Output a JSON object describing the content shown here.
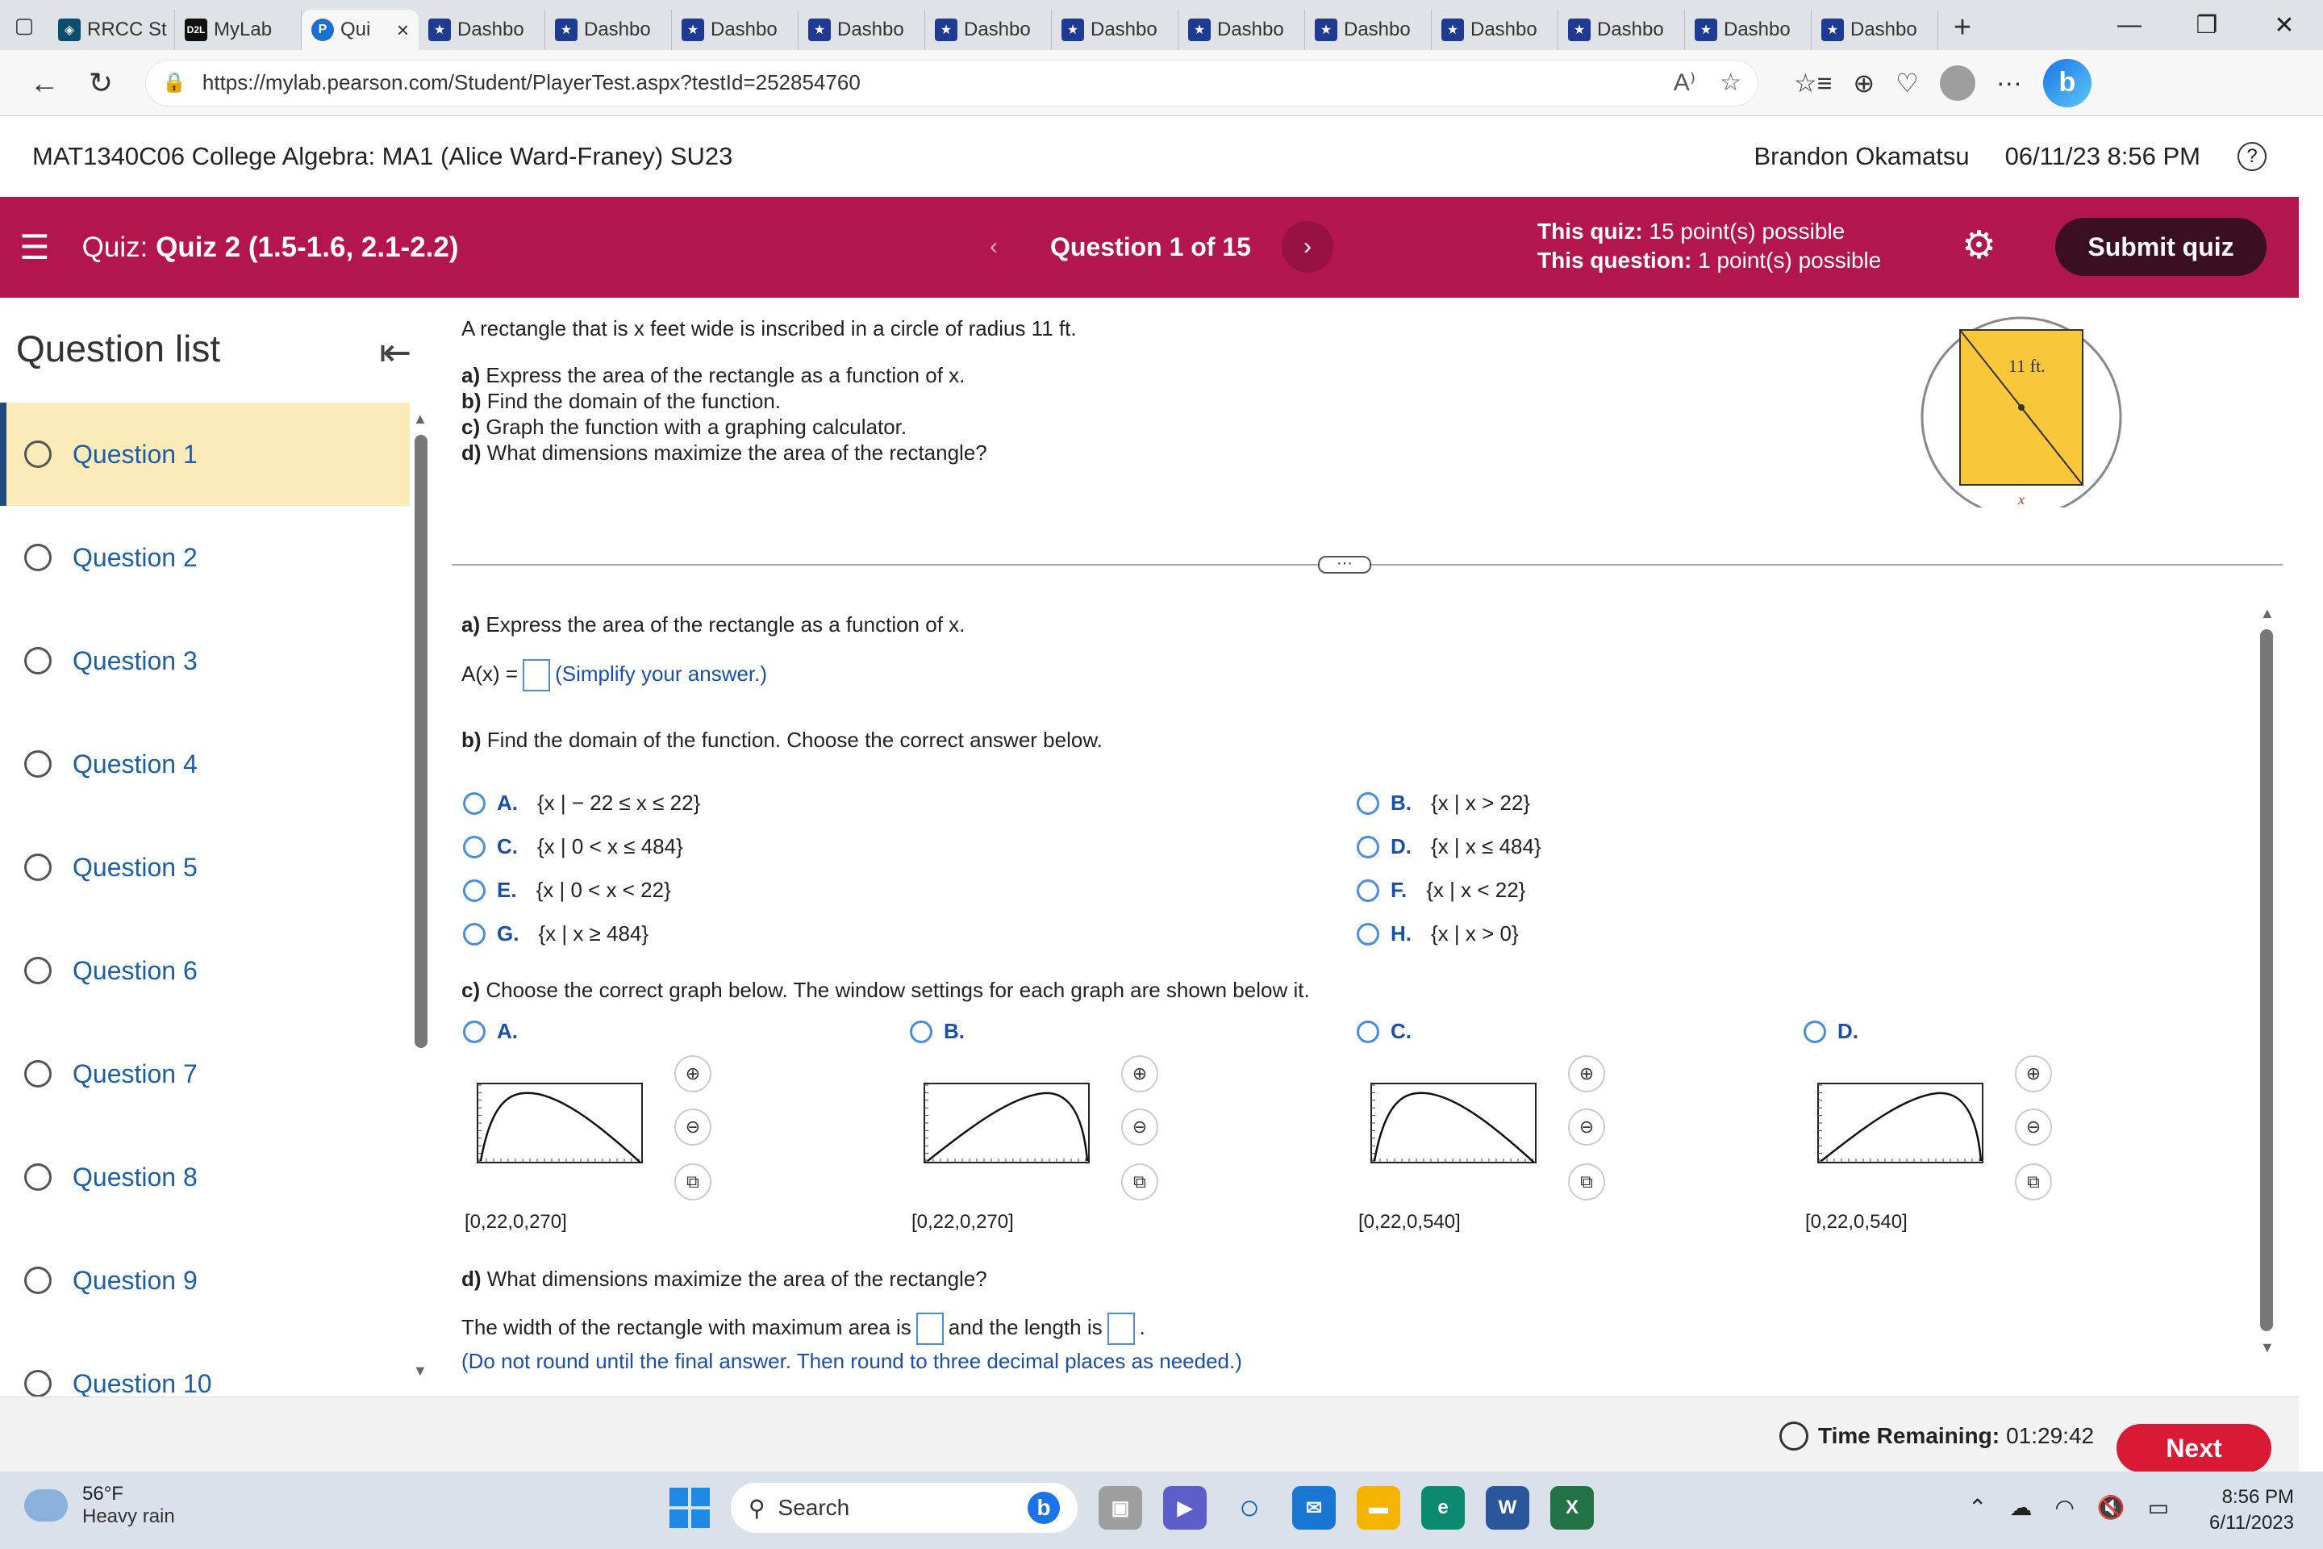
{
  "browser": {
    "tabs": [
      {
        "label": "RRCC St",
        "icon": "rrcc-icon"
      },
      {
        "label": "MyLab",
        "icon": "d2l-icon"
      },
      {
        "label": "Qui",
        "icon": "pearson-icon",
        "active": true
      },
      {
        "label": "Dashbo",
        "icon": "star-icon"
      },
      {
        "label": "Dashbo",
        "icon": "star-icon"
      },
      {
        "label": "Dashbo",
        "icon": "star-icon"
      },
      {
        "label": "Dashbo",
        "icon": "star-icon"
      },
      {
        "label": "Dashbo",
        "icon": "star-icon"
      },
      {
        "label": "Dashbo",
        "icon": "star-icon"
      },
      {
        "label": "Dashbo",
        "icon": "star-icon"
      },
      {
        "label": "Dashbo",
        "icon": "star-icon"
      },
      {
        "label": "Dashbo",
        "icon": "star-icon"
      },
      {
        "label": "Dashbo",
        "icon": "star-icon"
      },
      {
        "label": "Dashbo",
        "icon": "star-icon"
      },
      {
        "label": "Dashbo",
        "icon": "star-icon"
      }
    ],
    "url": "https://mylab.pearson.com/Student/PlayerTest.aspx?testId=252854760"
  },
  "course": {
    "title": "MAT1340C06 College Algebra: MA1 (Alice Ward-Franey) SU23",
    "user": "Brandon Okamatsu",
    "datetime": "06/11/23 8:56 PM"
  },
  "quiz": {
    "prefix": "Quiz:",
    "name": "Quiz 2 (1.5-1.6, 2.1-2.2)",
    "question_position": "Question 1 of 15",
    "quiz_points_label": "This quiz:",
    "quiz_points_value": "15 point(s) possible",
    "question_points_label": "This question:",
    "question_points_value": "1 point(s) possible",
    "submit_label": "Submit quiz",
    "accent_color": "#b2164d"
  },
  "question_list": {
    "title": "Question list",
    "items": [
      "Question 1",
      "Question 2",
      "Question 3",
      "Question 4",
      "Question 5",
      "Question 6",
      "Question 7",
      "Question 8",
      "Question 9",
      "Question 10"
    ],
    "active_index": 0
  },
  "question": {
    "stem": "A rectangle that is x feet wide is inscribed in a circle of radius 11 ft.",
    "parts": [
      {
        "label": "a)",
        "text": "Express the area of the rectangle as a function of x."
      },
      {
        "label": "b)",
        "text": "Find the domain of the function."
      },
      {
        "label": "c)",
        "text": "Graph the function with a graphing calculator."
      },
      {
        "label": "d)",
        "text": "What dimensions maximize the area of the rectangle?"
      }
    ],
    "figure": {
      "radius_label": "11 ft.",
      "width_label": "x"
    },
    "part_a": {
      "label": "a)",
      "prompt": "Express the area of the rectangle as a function of x.",
      "answer_prefix": "A(x) =",
      "hint": "(Simplify your answer.)"
    },
    "part_b": {
      "label": "b)",
      "prompt": "Find the domain of the function. Choose the correct answer below.",
      "choices": [
        {
          "letter": "A.",
          "text": "{x |  − 22 ≤ x ≤ 22}"
        },
        {
          "letter": "B.",
          "text": "{x | x > 22}"
        },
        {
          "letter": "C.",
          "text": "{x | 0 < x ≤ 484}"
        },
        {
          "letter": "D.",
          "text": "{x | x ≤ 484}"
        },
        {
          "letter": "E.",
          "text": "{x | 0 < x < 22}"
        },
        {
          "letter": "F.",
          "text": "{x | x < 22}"
        },
        {
          "letter": "G.",
          "text": "{x | x ≥ 484}"
        },
        {
          "letter": "H.",
          "text": "{x | x > 0}"
        }
      ]
    },
    "part_c": {
      "label": "c)",
      "prompt": "Choose the correct graph below. The window settings for each graph are shown below it.",
      "graphs": [
        {
          "letter": "A.",
          "window": "[0,22,0,270]",
          "shape": "peak-left"
        },
        {
          "letter": "B.",
          "window": "[0,22,0,270]",
          "shape": "peak-right"
        },
        {
          "letter": "C.",
          "window": "[0,22,0,540]",
          "shape": "peak-left"
        },
        {
          "letter": "D.",
          "window": "[0,22,0,540]",
          "shape": "peak-right"
        }
      ]
    },
    "part_d": {
      "label": "d)",
      "prompt": "What dimensions maximize the area of the rectangle?",
      "sentence_start": "The width of the rectangle with maximum area is",
      "sentence_mid": "and the length is",
      "sentence_end": ".",
      "hint": "(Do not round until the final answer. Then round to three decimal places as needed.)"
    }
  },
  "footer": {
    "timer_label": "Time Remaining:",
    "timer_value": "01:29:42",
    "next_label": "Next",
    "next_color": "#d91a35"
  },
  "taskbar": {
    "temperature": "56°F",
    "weather": "Heavy rain",
    "search_placeholder": "Search",
    "time": "8:56 PM",
    "date": "6/11/2023"
  }
}
